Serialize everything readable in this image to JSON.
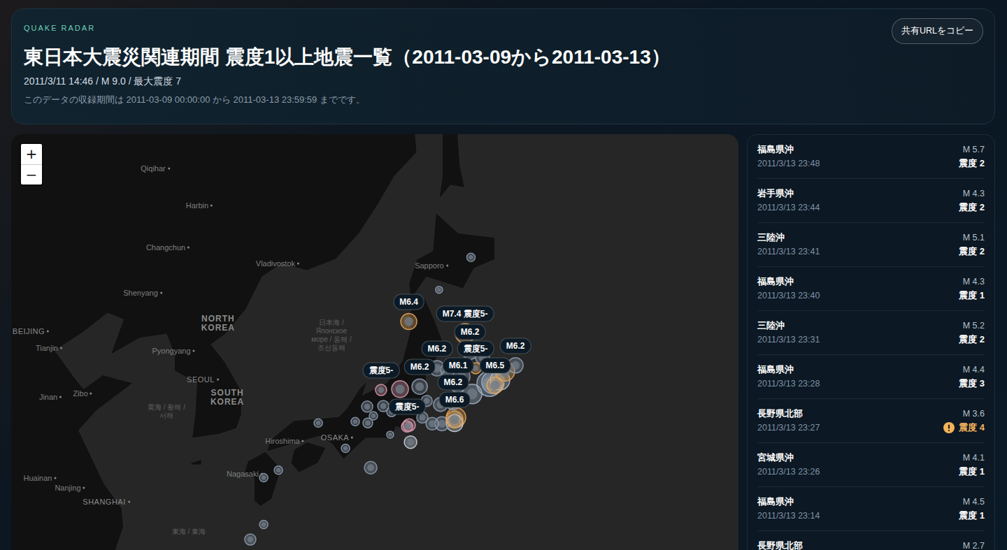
{
  "header": {
    "eyebrow": "QUAKE RADAR",
    "title": "東日本大震災関連期間 震度1以上地震一覧（2011-03-09から2011-03-13）",
    "subtitle": "2011/3/11 14:46 / M 9.0 / 最大震度 7",
    "note": "このデータの収録期間は 2011-03-09 00:00:00 から 2011-03-13 23:59:59 までです。",
    "share_button": "共有URLをコピー"
  },
  "map": {
    "zoom": {
      "in": "+",
      "out": "−"
    },
    "places": [
      {
        "text": "Qiqihar",
        "kind": "city",
        "lat": 47.32,
        "lon": 124.0
      },
      {
        "text": "Harbin",
        "kind": "city",
        "lat": 45.73,
        "lon": 126.76
      },
      {
        "text": "Changchun",
        "kind": "city",
        "lat": 43.86,
        "lon": 124.79
      },
      {
        "text": "Vladivostok",
        "kind": "city",
        "lat": 43.12,
        "lon": 131.67
      },
      {
        "text": "Shenyang",
        "kind": "city",
        "lat": 41.76,
        "lon": 123.21
      },
      {
        "text": "Sapporo",
        "kind": "city",
        "lat": 43.02,
        "lon": 141.32
      },
      {
        "text": "NORTH KOREA",
        "kind": "country",
        "lat": 40.3,
        "lon": 127.94
      },
      {
        "text": "BEIJING",
        "kind": "capital",
        "lat": 39.94,
        "lon": 116.19
      },
      {
        "text": "Tianjin",
        "kind": "city",
        "lat": 39.12,
        "lon": 117.33
      },
      {
        "text": "Pyongyang",
        "kind": "city",
        "lat": 38.98,
        "lon": 125.14
      },
      {
        "text": "SEOUL",
        "kind": "capital",
        "lat": 37.57,
        "lon": 126.98
      },
      {
        "text": "SOUTH KOREA",
        "kind": "country",
        "lat": 36.67,
        "lon": 128.52
      },
      {
        "text": "Jinan",
        "kind": "city",
        "lat": 36.71,
        "lon": 117.42
      },
      {
        "text": "Zibo",
        "kind": "city",
        "lat": 36.88,
        "lon": 119.44
      },
      {
        "text": "Hiroshima",
        "kind": "city",
        "lat": 34.44,
        "lon": 132.11
      },
      {
        "text": "OSAKA",
        "kind": "capital",
        "lat": 34.65,
        "lon": 135.4
      },
      {
        "text": "Nagasaki",
        "kind": "city",
        "lat": 32.72,
        "lon": 129.61
      },
      {
        "text": "Huainan",
        "kind": "city",
        "lat": 32.53,
        "lon": 116.76
      },
      {
        "text": "Nanjing",
        "kind": "city",
        "lat": 32.0,
        "lon": 118.65
      },
      {
        "text": "SHANGHAI",
        "kind": "capital",
        "lat": 31.26,
        "lon": 120.93
      },
      {
        "text": "日本海 / Японское море / 동해 / 조선동해",
        "kind": "sea",
        "lat": 39.74,
        "lon": 135.05
      },
      {
        "text": "黄海 / 황해 / 서해",
        "kind": "sea",
        "lat": 35.96,
        "lon": 124.7
      },
      {
        "text": "東海 / 東海",
        "kind": "sea",
        "lat": 29.63,
        "lon": 126.1
      }
    ],
    "markers": [
      {
        "lat": 43.4,
        "lon": 143.8,
        "magnitude": 4.2,
        "color": "#8b9bb0"
      },
      {
        "lat": 41.9,
        "lon": 141.8,
        "magnitude": 3.8,
        "color": "#8b9bb0"
      },
      {
        "lat": 40.4,
        "lon": 139.9,
        "magnitude": 6.4,
        "color": "#e8a65a",
        "label": "M6.4"
      },
      {
        "lat": 37.36,
        "lon": 144.96,
        "magnitude": 9.0,
        "color": "#9fb3c8"
      },
      {
        "lat": 37.43,
        "lon": 145.18,
        "magnitude": 8.2,
        "color": "#9fb3c8"
      },
      {
        "lat": 37.54,
        "lon": 145.62,
        "magnitude": 7.4,
        "color": "#b0bccc"
      },
      {
        "lat": 37.98,
        "lon": 145.93,
        "magnitude": 7.4,
        "color": "#e8a65a"
      },
      {
        "lat": 35.66,
        "lon": 142.86,
        "magnitude": 7.4,
        "color": "#e8a65a"
      },
      {
        "lat": 35.37,
        "lon": 142.77,
        "magnitude": 6.6,
        "color": "#c9d3de"
      },
      {
        "lat": 35.34,
        "lon": 141.98,
        "magnitude": 5.8,
        "color": "#8b9bb0"
      },
      {
        "lat": 35.34,
        "lon": 141.37,
        "magnitude": 5.4,
        "color": "#8b9bb0"
      },
      {
        "lat": 35.66,
        "lon": 140.75,
        "magnitude": 5.0,
        "color": "#8b9bb0"
      },
      {
        "lat": 37.09,
        "lon": 139.35,
        "magnitude": 6.6,
        "color": "#d99aae"
      },
      {
        "lat": 36.24,
        "lon": 138.3,
        "magnitude": 5.0,
        "color": "#8b9bb0"
      },
      {
        "lat": 36.21,
        "lon": 137.29,
        "magnitude": 5.0,
        "color": "#8b9bb0"
      },
      {
        "lat": 35.74,
        "lon": 137.68,
        "magnitude": 4.2,
        "color": "#8b9bb0"
      },
      {
        "lat": 35.45,
        "lon": 136.54,
        "magnitude": 4.2,
        "color": "#8b9bb0"
      },
      {
        "lat": 35.38,
        "lon": 137.33,
        "magnitude": 4.6,
        "color": "#8b9bb0"
      },
      {
        "lat": 35.27,
        "lon": 139.92,
        "magnitude": 5.4,
        "color": "#d99aae"
      },
      {
        "lat": 34.39,
        "lon": 140.01,
        "magnitude": 5.4,
        "color": "#c9d3de"
      },
      {
        "lat": 34.78,
        "lon": 138.73,
        "magnitude": 3.8,
        "color": "#8b9bb0"
      },
      {
        "lat": 35.38,
        "lon": 134.22,
        "magnitude": 4.2,
        "color": "#8b9bb0"
      },
      {
        "lat": 34.07,
        "lon": 135.93,
        "magnitude": 4.2,
        "color": "#8b9bb0"
      },
      {
        "lat": 33.06,
        "lon": 137.51,
        "magnitude": 5.4,
        "color": "#8b9bb0"
      },
      {
        "lat": 32.53,
        "lon": 130.8,
        "magnitude": 4.2,
        "color": "#8b9bb0"
      },
      {
        "lat": 32.93,
        "lon": 131.72,
        "magnitude": 4.2,
        "color": "#8b9bb0"
      },
      {
        "lat": 30.02,
        "lon": 130.8,
        "magnitude": 4.2,
        "color": "#8b9bb0"
      },
      {
        "lat": 29.2,
        "lon": 129.96,
        "magnitude": 5.0,
        "color": "#8b9bb0"
      },
      {
        "lat": 38.67,
        "lon": 144.52,
        "magnitude": 5.8,
        "color": "#8b9bb0"
      },
      {
        "lat": 38.05,
        "lon": 142.33,
        "magnitude": 5.8,
        "color": "#8b9bb0"
      },
      {
        "lat": 37.71,
        "lon": 143.21,
        "magnitude": 6.6,
        "color": "#8b9bb0"
      },
      {
        "lat": 36.85,
        "lon": 143.87,
        "magnitude": 7.4,
        "color": "#9fb3c8"
      },
      {
        "lat": 36.32,
        "lon": 141.89,
        "magnitude": 5.8,
        "color": "#8b9bb0"
      },
      {
        "lat": 36.5,
        "lon": 141.02,
        "magnitude": 5.0,
        "color": "#8b9bb0"
      },
      {
        "lat": 35.95,
        "lon": 138.82,
        "magnitude": 4.6,
        "color": "#8b9bb0"
      },
      {
        "lat": 39.83,
        "lon": 143.43,
        "magnitude": 7.4,
        "color": "#e8a65a",
        "label": "M7.4 震度5-"
      },
      {
        "lat": 38.94,
        "lon": 143.74,
        "magnitude": 6.2,
        "color": "#8b9bb0",
        "label": "M6.2"
      },
      {
        "lat": 38.13,
        "lon": 141.67,
        "magnitude": 6.2,
        "color": "#8b9bb0",
        "label": "M6.2"
      },
      {
        "lat": 38.13,
        "lon": 144.09,
        "magnitude": 5.0,
        "color": "#e8a65a",
        "label": "震度5-"
      },
      {
        "lat": 38.27,
        "lon": 146.59,
        "magnitude": 6.2,
        "color": "#8b9bb0",
        "label": "M6.2"
      },
      {
        "lat": 37.29,
        "lon": 142.99,
        "magnitude": 6.1,
        "color": "#8b9bb0",
        "label": "M6.1"
      },
      {
        "lat": 37.29,
        "lon": 145.31,
        "magnitude": 6.5,
        "color": "#e8a65a",
        "label": "M6.5"
      },
      {
        "lat": 37.22,
        "lon": 140.58,
        "magnitude": 6.2,
        "color": "#8b9bb0",
        "label": "M6.2"
      },
      {
        "lat": 37.05,
        "lon": 138.16,
        "magnitude": 5.0,
        "color": "#d99aae",
        "label": "震度5-"
      },
      {
        "lat": 36.44,
        "lon": 142.68,
        "magnitude": 6.2,
        "color": "#8b9bb0",
        "label": "M6.2"
      },
      {
        "lat": 35.56,
        "lon": 142.77,
        "magnitude": 6.6,
        "color": "#e8a65a",
        "label": "M6.6"
      },
      {
        "lat": 35.2,
        "lon": 139.79,
        "magnitude": 5.0,
        "color": "#d99aae",
        "label": "震度5-"
      }
    ]
  },
  "events": [
    {
      "place": "福島県沖",
      "time": "2011/3/13 23:48",
      "magnitude": "M 5.7",
      "intensity": "震度 2",
      "alert": false
    },
    {
      "place": "岩手県沖",
      "time": "2011/3/13 23:44",
      "magnitude": "M 4.3",
      "intensity": "震度 2",
      "alert": false
    },
    {
      "place": "三陸沖",
      "time": "2011/3/13 23:41",
      "magnitude": "M 5.1",
      "intensity": "震度 2",
      "alert": false
    },
    {
      "place": "福島県沖",
      "time": "2011/3/13 23:40",
      "magnitude": "M 4.3",
      "intensity": "震度 1",
      "alert": false
    },
    {
      "place": "三陸沖",
      "time": "2011/3/13 23:31",
      "magnitude": "M 5.2",
      "intensity": "震度 2",
      "alert": false
    },
    {
      "place": "福島県沖",
      "time": "2011/3/13 23:28",
      "magnitude": "M 4.4",
      "intensity": "震度 3",
      "alert": false
    },
    {
      "place": "長野県北部",
      "time": "2011/3/13 23:27",
      "magnitude": "M 3.6",
      "intensity": "震度 4",
      "alert": true
    },
    {
      "place": "宮城県沖",
      "time": "2011/3/13 23:26",
      "magnitude": "M 4.1",
      "intensity": "震度 1",
      "alert": false
    },
    {
      "place": "福島県沖",
      "time": "2011/3/13 23:14",
      "magnitude": "M 4.5",
      "intensity": "震度 1",
      "alert": false
    },
    {
      "place": "長野県北部",
      "magnitude": "M 2.7",
      "alert": false
    }
  ]
}
